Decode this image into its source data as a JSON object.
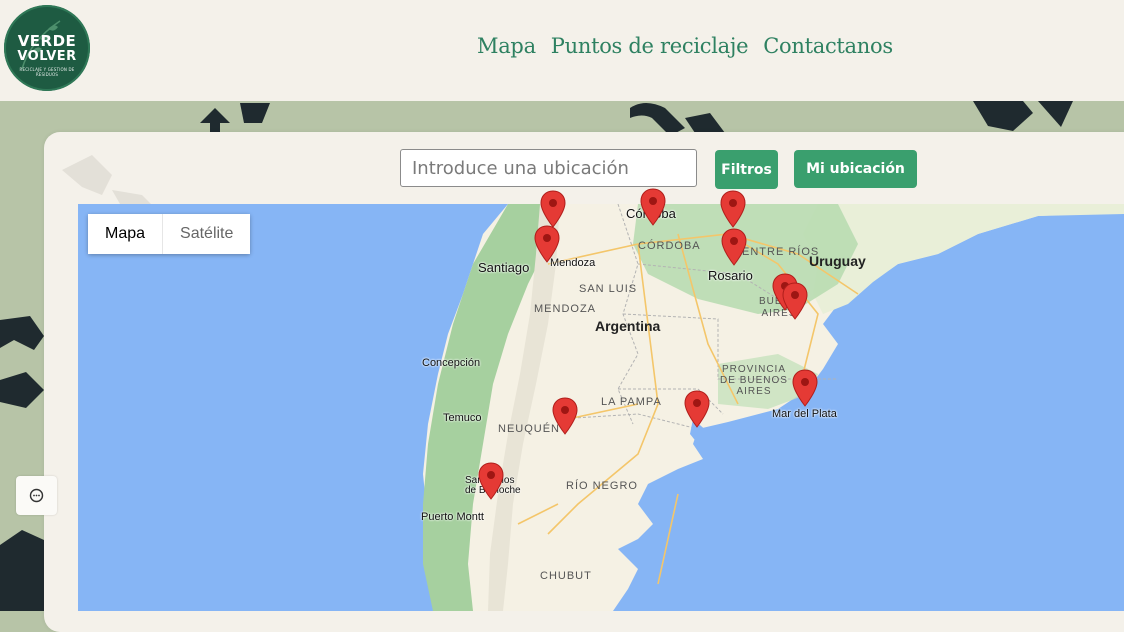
{
  "header": {
    "logo_line1": "VERDE",
    "logo_line2": "VOLVER",
    "logo_tagline": "RECICLAJE Y GESTIÓN DE RESIDUOS",
    "nav": [
      "Mapa",
      "Puntos de reciclaje",
      "Contactanos"
    ]
  },
  "search": {
    "placeholder": "Introduce una ubicación"
  },
  "buttons": {
    "filters": "Filtros",
    "my_location": "Mi ubicación"
  },
  "map": {
    "type_options": [
      "Mapa",
      "Satélite"
    ],
    "selected_type": "Mapa",
    "labels": {
      "country": "Argentina",
      "uruguay": "Uruguay",
      "santiago": "Santiago",
      "mendoza_city": "Mendoza",
      "cordoba_city": "Córdoba",
      "rosario": "Rosario",
      "concepcion": "Concepción",
      "temuco": "Temuco",
      "puerto_montt": "Puerto Montt",
      "bariloche": "San Carlos de Bariloche",
      "mar_del_plata": "Mar del Plata",
      "cordoba_prov": "CÓRDOBA",
      "entre_rios": "ENTRE RÍOS",
      "san_luis": "SAN LUIS",
      "mendoza_prov": "MENDOZA",
      "la_pampa": "LA PAMPA",
      "neuquen": "NEUQUÉN",
      "rio_negro": "RÍO NEGRO",
      "chubut": "CHUBUT",
      "buenos_aires_prov": "PROVINCIA DE BUENOS AIRES",
      "buenos_aires_city": "BUENOS AIRES"
    },
    "markers": [
      {
        "name": "San Juan"
      },
      {
        "name": "Mendoza"
      },
      {
        "name": "Córdoba"
      },
      {
        "name": "Santa Fe"
      },
      {
        "name": "Rosario"
      },
      {
        "name": "Buenos Aires 1"
      },
      {
        "name": "Buenos Aires 2"
      },
      {
        "name": "Neuquén"
      },
      {
        "name": "Bahía Blanca"
      },
      {
        "name": "Mar del Plata"
      },
      {
        "name": "Bariloche"
      }
    ]
  },
  "colors": {
    "brand_green": "#3a9f6e",
    "nav_text": "#2e8161",
    "logo_bg": "#1e5b42",
    "header_bg": "#f4f1ea",
    "water": "#86b5f5",
    "land": "#f5f1e4",
    "vegetation": "#a9d3a3",
    "marker": "#e53a35"
  }
}
